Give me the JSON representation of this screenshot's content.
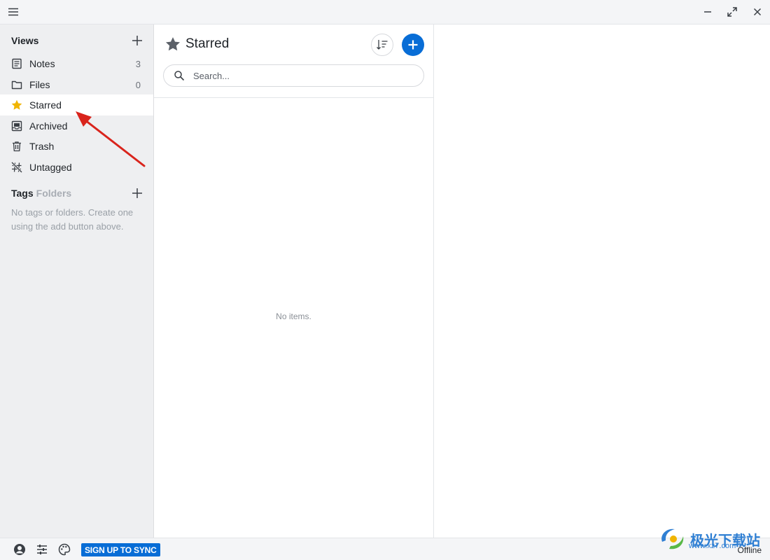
{
  "titlebar": {
    "icons": [
      "hamburger-menu-icon",
      "minimize-icon",
      "maximize-icon",
      "close-icon"
    ]
  },
  "sidebar": {
    "views_title": "Views",
    "views": [
      {
        "label": "Notes",
        "count": "3",
        "icon": "notes-icon"
      },
      {
        "label": "Files",
        "count": "0",
        "icon": "folder-icon"
      },
      {
        "label": "Starred",
        "count": "",
        "icon": "star-icon"
      },
      {
        "label": "Archived",
        "count": "",
        "icon": "archive-icon"
      },
      {
        "label": "Trash",
        "count": "",
        "icon": "trash-icon"
      },
      {
        "label": "Untagged",
        "count": "",
        "icon": "untagged-icon"
      }
    ],
    "active_view": "Starred",
    "tags_title": "Tags",
    "folders_label": "Folders",
    "tags_empty": "No tags or folders. Create one using the add button above."
  },
  "list": {
    "title": "Starred",
    "search_placeholder": "Search...",
    "empty_text": "No items."
  },
  "footer": {
    "icons": [
      "account-icon",
      "preferences-icon",
      "themes-icon"
    ],
    "sync_button": "SIGN UP TO SYNC",
    "status": "Offline"
  },
  "watermark": {
    "text": "极光下载站",
    "url": "www.xz7.com"
  },
  "colors": {
    "accent": "#086dd6",
    "star": "#f0b400",
    "annotation_arrow": "#d9241c"
  }
}
